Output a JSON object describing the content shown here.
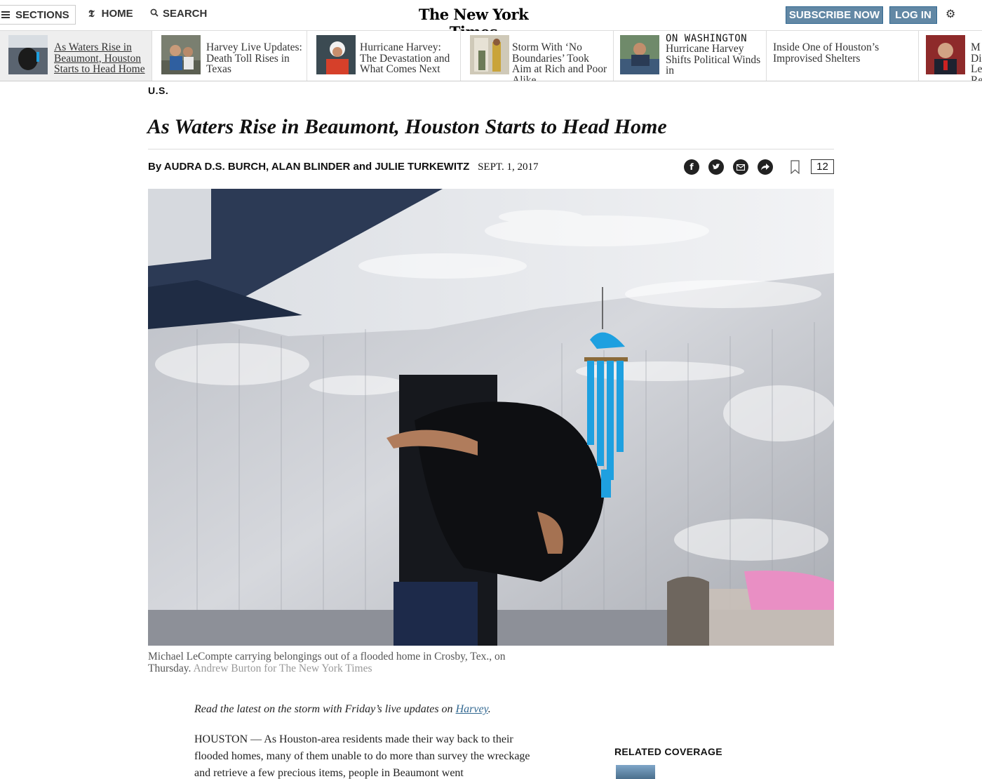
{
  "topbar": {
    "sections_label": "SECTIONS",
    "home_label": "HOME",
    "search_label": "SEARCH",
    "logo_text": "The New York Times",
    "subscribe_label": "SUBSCRIBE NOW",
    "login_label": "LOG IN",
    "settings_icon": "gear-icon"
  },
  "ribbon": {
    "items": [
      {
        "title": "As Waters Rise in Beaumont, Houston Starts to Head Home",
        "active": true
      },
      {
        "title": "Harvey Live Updates: Death Toll Rises in Texas"
      },
      {
        "title": "Hurricane Harvey: The Devastation and What Comes Next"
      },
      {
        "title": "Storm With ‘No Boundaries’ Took Aim at Rich and Poor Alike"
      },
      {
        "kicker": "ON WASHINGTON",
        "title": "Hurricane Harvey Shifts Political Winds in"
      },
      {
        "title": "Inside One of Houston’s Improvised Shelters"
      },
      {
        "title": "M Di Le Reasons fo"
      }
    ]
  },
  "article": {
    "kicker": "U.S.",
    "headline": "As Waters Rise in Beaumont, Houston Starts to Head Home",
    "byline": "By AUDRA D.S. BURCH, ALAN BLINDER and JULIE TURKEWITZ",
    "date": "SEPT. 1, 2017",
    "comment_count": "12",
    "caption": "Michael LeCompte carrying belongings out of a flooded home in Crosby, Tex., on Thursday.",
    "credit": "Andrew Burton for The New York Times",
    "lede_prefix": "Read the latest on the storm with Friday’s live updates on ",
    "lede_link": "Harvey",
    "lede_suffix": ".",
    "body": "HOUSTON — As Houston-area residents made their way back to their flooded homes, many of them unable to do more than survey the wreckage and retrieve a few precious items, people in Beaumont went",
    "related_heading": "RELATED COVERAGE"
  },
  "colors": {
    "button_blue": "#6288a5",
    "link_blue": "#326891",
    "chime_blue": "#1ea0e0"
  }
}
